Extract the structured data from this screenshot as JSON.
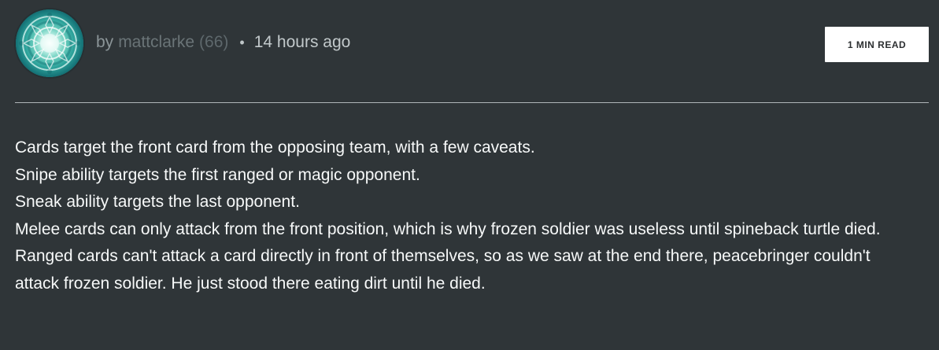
{
  "post": {
    "author": {
      "by_label": "by",
      "username": "mattclarke",
      "reputation": "(66)",
      "separator": "•",
      "posted_time": "14 hours ago",
      "avatar_icon": "mandala-avatar-icon"
    },
    "read_time": "1 MIN READ",
    "paragraphs": [
      "Cards target the front card from the opposing team, with a few caveats.",
      "Snipe ability targets the first ranged or magic opponent.",
      "Sneak ability targets the last opponent.",
      "Melee cards can only attack from the front position, which is why frozen soldier was useless until spineback turtle died.",
      "Ranged cards can't attack a card directly in front of themselves, so as we saw at the end there, peacebringer couldn't attack frozen soldier. He just stood there eating dirt until he died."
    ]
  },
  "colors": {
    "background": "#2f3538",
    "text": "#f7f9f9",
    "author_link": "#6a7477",
    "time": "#c2c9cb",
    "badge_background": "#ffffff",
    "avatar_accent": "#67cdbd"
  }
}
